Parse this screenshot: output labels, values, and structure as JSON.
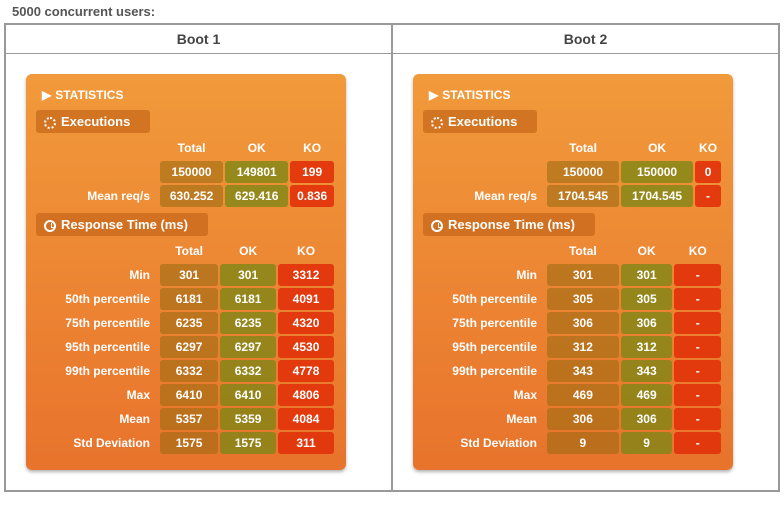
{
  "title": "5000 concurrent users:",
  "columns": [
    "Boot 1",
    "Boot 2"
  ],
  "labels": {
    "statistics": "STATISTICS",
    "executions": "Executions",
    "response": "Response Time (ms)",
    "total": "Total",
    "ok": "OK",
    "ko": "KO",
    "mean_reqs": "Mean req/s",
    "min": "Min",
    "p50": "50th percentile",
    "p75": "75th percentile",
    "p95": "95th percentile",
    "p99": "99th percentile",
    "max": "Max",
    "mean": "Mean",
    "std": "Std Deviation"
  },
  "boot1": {
    "exec": {
      "count": {
        "total": "150000",
        "ok": "149801",
        "ko": "199"
      },
      "reqs": {
        "total": "630.252",
        "ok": "629.416",
        "ko": "0.836"
      }
    },
    "resp": {
      "min": {
        "total": "301",
        "ok": "301",
        "ko": "3312"
      },
      "p50": {
        "total": "6181",
        "ok": "6181",
        "ko": "4091"
      },
      "p75": {
        "total": "6235",
        "ok": "6235",
        "ko": "4320"
      },
      "p95": {
        "total": "6297",
        "ok": "6297",
        "ko": "4530"
      },
      "p99": {
        "total": "6332",
        "ok": "6332",
        "ko": "4778"
      },
      "max": {
        "total": "6410",
        "ok": "6410",
        "ko": "4806"
      },
      "mean": {
        "total": "5357",
        "ok": "5359",
        "ko": "4084"
      },
      "std": {
        "total": "1575",
        "ok": "1575",
        "ko": "311"
      }
    }
  },
  "boot2": {
    "exec": {
      "count": {
        "total": "150000",
        "ok": "150000",
        "ko": "0"
      },
      "reqs": {
        "total": "1704.545",
        "ok": "1704.545",
        "ko": "-"
      }
    },
    "resp": {
      "min": {
        "total": "301",
        "ok": "301",
        "ko": "-"
      },
      "p50": {
        "total": "305",
        "ok": "305",
        "ko": "-"
      },
      "p75": {
        "total": "306",
        "ok": "306",
        "ko": "-"
      },
      "p95": {
        "total": "312",
        "ok": "312",
        "ko": "-"
      },
      "p99": {
        "total": "343",
        "ok": "343",
        "ko": "-"
      },
      "max": {
        "total": "469",
        "ok": "469",
        "ko": "-"
      },
      "mean": {
        "total": "306",
        "ok": "306",
        "ko": "-"
      },
      "std": {
        "total": "9",
        "ok": "9",
        "ko": "-"
      }
    }
  }
}
